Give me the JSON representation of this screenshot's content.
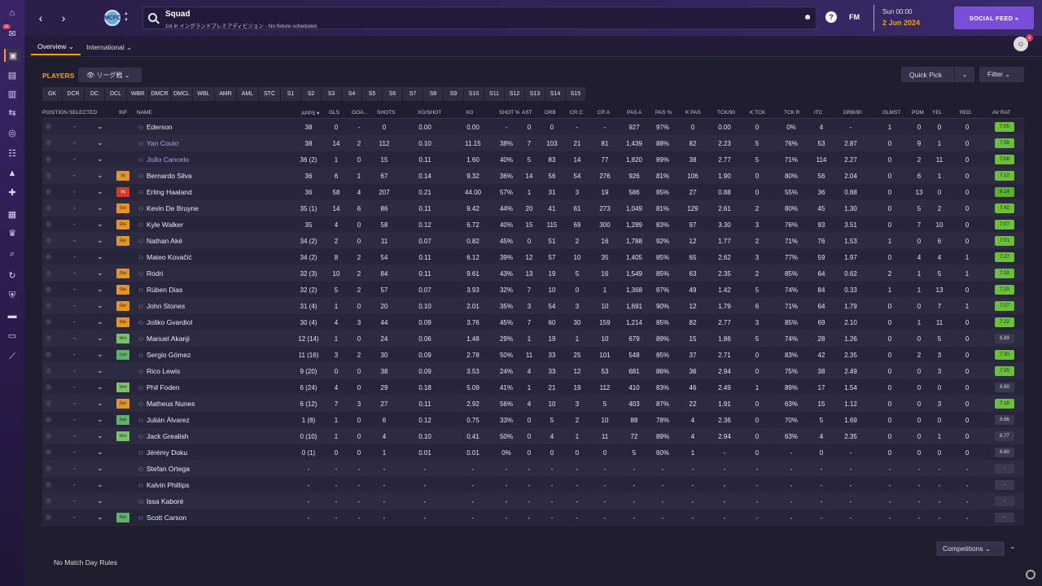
{
  "header": {
    "title": "Squad",
    "subtitle": "1st in イングランドプレミアディビジョン - No fixture scheduled.",
    "fm_label": "FM",
    "date_day": "Sun 00:00",
    "date_date": "2 Jun 2024",
    "social_feed": "SOCIAL FEED  »",
    "club_badge": "MCFC",
    "rail_badge": "16"
  },
  "tabs": [
    {
      "label": "Overview ⌄"
    },
    {
      "label": "International ⌄"
    }
  ],
  "people_badge": "3",
  "players_label": "PLAYERS",
  "view_select": "👁 リーグ戦  ⌄",
  "quick_pick": "Quick Pick",
  "filter": "Filter  ⌄",
  "positions": [
    "GK",
    "DCR",
    "DC",
    "DCL",
    "WBR",
    "DMCR",
    "DMCL",
    "WBL",
    "AMR",
    "AML",
    "STC",
    "S1",
    "S2",
    "S3",
    "S4",
    "S5",
    "S6",
    "S7",
    "S8",
    "S9",
    "S10",
    "S11",
    "S12",
    "S13",
    "S14",
    "S15"
  ],
  "columns": {
    "position_selected": "POSITION SELECTED",
    "inf": "INF",
    "name": "NAME",
    "apps": "APPS ▾",
    "gls": "GLS",
    "goa": "GOA...",
    "shots": "SHOTS",
    "xg_shot": "XG/SHOT",
    "xg": "XG",
    "shot_pct": "SHOT %",
    "ast": "AST",
    "drb": "DRB",
    "cr_c": "CR C",
    "cr_a": "CR A",
    "pas_a": "PAS A",
    "pas_pct": "PAS %",
    "k_pas": "K PAS",
    "tck90": "TCK/90",
    "k_tck": "K TCK",
    "tck_r": "TCK R",
    "itc": "ITC",
    "drb90": "DRB/90",
    "glmst": "GLMST",
    "pom": "POM",
    "yel": "YEL",
    "red": "RED",
    "av_rat": "AV RAT"
  },
  "players": [
    {
      "inf": "",
      "name": "Ederson",
      "loan": false,
      "apps": "38",
      "gls": "0",
      "goa": "-",
      "shots": "0",
      "xgs": "0.00",
      "xg": "0.00",
      "shotp": "-",
      "ast": "0",
      "drb": "0",
      "crc": "-",
      "cra": "-",
      "pasa": "927",
      "pasp": "97%",
      "kpas": "0",
      "tck90": "0.00",
      "ktck": "0",
      "tckr": "0%",
      "itc": "4",
      "drb90": "-",
      "glmst": "1",
      "pom": "0",
      "yel": "0",
      "red": "0",
      "avrat": "7.05",
      "rc": "g"
    },
    {
      "inf": "",
      "name": "Yan Couto",
      "loan": true,
      "apps": "38",
      "gls": "14",
      "goa": "2",
      "shots": "112",
      "xgs": "0.10",
      "xg": "11.15",
      "shotp": "38%",
      "ast": "7",
      "drb": "103",
      "crc": "21",
      "cra": "81",
      "pasa": "1,439",
      "pasp": "88%",
      "kpas": "82",
      "tck90": "2.23",
      "ktck": "5",
      "tckr": "76%",
      "itc": "53",
      "drb90": "2.87",
      "glmst": "0",
      "pom": "9",
      "yel": "1",
      "red": "0",
      "avrat": "7.58",
      "rc": "g"
    },
    {
      "inf": "",
      "name": "João Cancelo",
      "loan": true,
      "apps": "36 (2)",
      "gls": "1",
      "goa": "0",
      "shots": "15",
      "xgs": "0.11",
      "xg": "1.60",
      "shotp": "40%",
      "ast": "5",
      "drb": "83",
      "crc": "14",
      "cra": "77",
      "pasa": "1,820",
      "pasp": "89%",
      "kpas": "38",
      "tck90": "2.77",
      "ktck": "5",
      "tckr": "71%",
      "itc": "114",
      "drb90": "2.27",
      "glmst": "0",
      "pom": "2",
      "yel": "11",
      "red": "0",
      "avrat": "7.08",
      "rc": "g"
    },
    {
      "inf": "Inj",
      "name": "Bernardo Silva",
      "loan": false,
      "apps": "36",
      "gls": "6",
      "goa": "1",
      "shots": "67",
      "xgs": "0.14",
      "xg": "9.32",
      "shotp": "36%",
      "ast": "14",
      "drb": "56",
      "crc": "54",
      "cra": "276",
      "pasa": "926",
      "pasp": "81%",
      "kpas": "106",
      "tck90": "1.90",
      "ktck": "0",
      "tckr": "80%",
      "itc": "56",
      "drb90": "2.04",
      "glmst": "0",
      "pom": "6",
      "yel": "1",
      "red": "0",
      "avrat": "7.12",
      "rc": "g",
      "infc": "rst"
    },
    {
      "inf": "Inj",
      "name": "Erling Haaland",
      "loan": false,
      "apps": "36",
      "gls": "58",
      "goa": "4",
      "shots": "207",
      "xgs": "0.21",
      "xg": "44.00",
      "shotp": "57%",
      "ast": "1",
      "drb": "31",
      "crc": "3",
      "cra": "19",
      "pasa": "586",
      "pasp": "85%",
      "kpas": "27",
      "tck90": "0.88",
      "ktck": "0",
      "tckr": "55%",
      "itc": "36",
      "drb90": "0.88",
      "glmst": "0",
      "pom": "13",
      "yel": "0",
      "red": "0",
      "avrat": "8.14",
      "rc": "dg",
      "infc": "inj"
    },
    {
      "inf": "Rst",
      "name": "Kevin De Bruyne",
      "loan": false,
      "apps": "35 (1)",
      "gls": "14",
      "goa": "6",
      "shots": "86",
      "xgs": "0.11",
      "xg": "9.42",
      "shotp": "44%",
      "ast": "20",
      "drb": "41",
      "crc": "61",
      "cra": "273",
      "pasa": "1,049",
      "pasp": "81%",
      "kpas": "129",
      "tck90": "2.61",
      "ktck": "2",
      "tckr": "80%",
      "itc": "45",
      "drb90": "1.30",
      "glmst": "0",
      "pom": "5",
      "yel": "2",
      "red": "0",
      "avrat": "7.42",
      "rc": "g",
      "infc": "rst"
    },
    {
      "inf": "Rst",
      "name": "Kyle Walker",
      "loan": false,
      "apps": "35",
      "gls": "4",
      "goa": "0",
      "shots": "58",
      "xgs": "0.12",
      "xg": "6.72",
      "shotp": "40%",
      "ast": "15",
      "drb": "115",
      "crc": "69",
      "cra": "300",
      "pasa": "1,289",
      "pasp": "83%",
      "kpas": "97",
      "tck90": "3.30",
      "ktck": "3",
      "tckr": "76%",
      "itc": "93",
      "drb90": "3.51",
      "glmst": "0",
      "pom": "7",
      "yel": "10",
      "red": "0",
      "avrat": "7.07",
      "rc": "g",
      "infc": "rst"
    },
    {
      "inf": "Rst",
      "name": "Nathan Aké",
      "loan": false,
      "apps": "34 (2)",
      "gls": "2",
      "goa": "0",
      "shots": "11",
      "xgs": "0.07",
      "xg": "0.82",
      "shotp": "45%",
      "ast": "0",
      "drb": "51",
      "crc": "2",
      "cra": "16",
      "pasa": "1,788",
      "pasp": "92%",
      "kpas": "12",
      "tck90": "1.77",
      "ktck": "2",
      "tckr": "71%",
      "itc": "76",
      "drb90": "1.53",
      "glmst": "1",
      "pom": "0",
      "yel": "6",
      "red": "0",
      "avrat": "7.01",
      "rc": "g",
      "infc": "rst"
    },
    {
      "inf": "",
      "name": "Mateo Kovačić",
      "loan": false,
      "apps": "34 (2)",
      "gls": "8",
      "goa": "2",
      "shots": "54",
      "xgs": "0.11",
      "xg": "6.12",
      "shotp": "39%",
      "ast": "12",
      "drb": "57",
      "crc": "10",
      "cra": "35",
      "pasa": "1,405",
      "pasp": "85%",
      "kpas": "65",
      "tck90": "2.62",
      "ktck": "3",
      "tckr": "77%",
      "itc": "59",
      "drb90": "1.97",
      "glmst": "0",
      "pom": "4",
      "yel": "4",
      "red": "1",
      "avrat": "7.27",
      "rc": "g"
    },
    {
      "inf": "Rst",
      "name": "Rodri",
      "loan": false,
      "apps": "32 (3)",
      "gls": "10",
      "goa": "2",
      "shots": "84",
      "xgs": "0.11",
      "xg": "9.61",
      "shotp": "43%",
      "ast": "13",
      "drb": "19",
      "crc": "5",
      "cra": "16",
      "pasa": "1,549",
      "pasp": "85%",
      "kpas": "63",
      "tck90": "2.35",
      "ktck": "2",
      "tckr": "85%",
      "itc": "64",
      "drb90": "0.62",
      "glmst": "2",
      "pom": "1",
      "yel": "5",
      "red": "1",
      "avrat": "7.32",
      "rc": "g",
      "infc": "rst"
    },
    {
      "inf": "Rst",
      "name": "Rúben Dias",
      "loan": false,
      "apps": "32 (2)",
      "gls": "5",
      "goa": "2",
      "shots": "57",
      "xgs": "0.07",
      "xg": "3.93",
      "shotp": "32%",
      "ast": "7",
      "drb": "10",
      "crc": "0",
      "cra": "1",
      "pasa": "1,368",
      "pasp": "87%",
      "kpas": "49",
      "tck90": "1.42",
      "ktck": "5",
      "tckr": "74%",
      "itc": "84",
      "drb90": "0.33",
      "glmst": "1",
      "pom": "1",
      "yel": "13",
      "red": "0",
      "avrat": "7.20",
      "rc": "g",
      "infc": "rst"
    },
    {
      "inf": "Rst",
      "name": "John Stones",
      "loan": false,
      "apps": "31 (4)",
      "gls": "1",
      "goa": "0",
      "shots": "20",
      "xgs": "0.10",
      "xg": "2.01",
      "shotp": "35%",
      "ast": "3",
      "drb": "54",
      "crc": "3",
      "cra": "10",
      "pasa": "1,691",
      "pasp": "90%",
      "kpas": "12",
      "tck90": "1.79",
      "ktck": "6",
      "tckr": "71%",
      "itc": "64",
      "drb90": "1.79",
      "glmst": "0",
      "pom": "0",
      "yel": "7",
      "red": "1",
      "avrat": "7.07",
      "rc": "g",
      "infc": "rst"
    },
    {
      "inf": "Rst",
      "name": "Joško Gvardiol",
      "loan": false,
      "apps": "30 (4)",
      "gls": "4",
      "goa": "3",
      "shots": "44",
      "xgs": "0.09",
      "xg": "3.76",
      "shotp": "45%",
      "ast": "7",
      "drb": "60",
      "crc": "30",
      "cra": "159",
      "pasa": "1,214",
      "pasp": "85%",
      "kpas": "82",
      "tck90": "2.77",
      "ktck": "3",
      "tckr": "85%",
      "itc": "69",
      "drb90": "2.10",
      "glmst": "0",
      "pom": "1",
      "yel": "11",
      "red": "0",
      "avrat": "7.22",
      "rc": "g",
      "infc": "rst"
    },
    {
      "inf": "Wnt",
      "name": "Manuel Akanji",
      "loan": false,
      "apps": "12 (14)",
      "gls": "1",
      "goa": "0",
      "shots": "24",
      "xgs": "0.06",
      "xg": "1.48",
      "shotp": "29%",
      "ast": "1",
      "drb": "19",
      "crc": "1",
      "cra": "10",
      "pasa": "679",
      "pasp": "89%",
      "kpas": "15",
      "tck90": "1.86",
      "ktck": "5",
      "tckr": "74%",
      "itc": "28",
      "drb90": "1.26",
      "glmst": "0",
      "pom": "0",
      "yel": "5",
      "red": "0",
      "avrat": "6.89",
      "rc": "n",
      "infc": "wnt"
    },
    {
      "inf": "Loa",
      "name": "Sergio Gómez",
      "loan": false,
      "apps": "11 (16)",
      "gls": "3",
      "goa": "2",
      "shots": "30",
      "xgs": "0.09",
      "xg": "2.78",
      "shotp": "50%",
      "ast": "11",
      "drb": "33",
      "crc": "25",
      "cra": "101",
      "pasa": "548",
      "pasp": "85%",
      "kpas": "37",
      "tck90": "2.71",
      "ktck": "0",
      "tckr": "83%",
      "itc": "42",
      "drb90": "2.35",
      "glmst": "0",
      "pom": "2",
      "yel": "3",
      "red": "0",
      "avrat": "7.30",
      "rc": "g",
      "infc": "loa"
    },
    {
      "inf": "",
      "name": "Rico Lewis",
      "loan": false,
      "apps": "9 (20)",
      "gls": "0",
      "goa": "0",
      "shots": "38",
      "xgs": "0.09",
      "xg": "3.53",
      "shotp": "24%",
      "ast": "4",
      "drb": "33",
      "crc": "12",
      "cra": "53",
      "pasa": "681",
      "pasp": "86%",
      "kpas": "36",
      "tck90": "2.94",
      "ktck": "0",
      "tckr": "75%",
      "itc": "38",
      "drb90": "2.49",
      "glmst": "0",
      "pom": "0",
      "yel": "3",
      "red": "0",
      "avrat": "7.05",
      "rc": "g"
    },
    {
      "inf": "Wnt",
      "name": "Phil Foden",
      "loan": false,
      "apps": "6 (24)",
      "gls": "4",
      "goa": "0",
      "shots": "29",
      "xgs": "0.18",
      "xg": "5.09",
      "shotp": "41%",
      "ast": "1",
      "drb": "21",
      "crc": "19",
      "cra": "112",
      "pasa": "410",
      "pasp": "83%",
      "kpas": "46",
      "tck90": "2.49",
      "ktck": "1",
      "tckr": "89%",
      "itc": "17",
      "drb90": "1.54",
      "glmst": "0",
      "pom": "0",
      "yel": "0",
      "red": "0",
      "avrat": "6.90",
      "rc": "n",
      "infc": "wnt"
    },
    {
      "inf": "Rst",
      "name": "Matheus Nunes",
      "loan": false,
      "apps": "6 (12)",
      "gls": "7",
      "goa": "3",
      "shots": "27",
      "xgs": "0.11",
      "xg": "2.92",
      "shotp": "56%",
      "ast": "4",
      "drb": "10",
      "crc": "3",
      "cra": "5",
      "pasa": "403",
      "pasp": "87%",
      "kpas": "22",
      "tck90": "1.91",
      "ktck": "0",
      "tckr": "63%",
      "itc": "15",
      "drb90": "1.12",
      "glmst": "0",
      "pom": "0",
      "yel": "3",
      "red": "0",
      "avrat": "7.18",
      "rc": "g",
      "infc": "rst"
    },
    {
      "inf": "Ask",
      "name": "Julián Álvarez",
      "loan": false,
      "apps": "1 (8)",
      "gls": "1",
      "goa": "0",
      "shots": "6",
      "xgs": "0.12",
      "xg": "0.75",
      "shotp": "33%",
      "ast": "0",
      "drb": "5",
      "crc": "2",
      "cra": "10",
      "pasa": "88",
      "pasp": "78%",
      "kpas": "4",
      "tck90": "2.36",
      "ktck": "0",
      "tckr": "70%",
      "itc": "5",
      "drb90": "1.69",
      "glmst": "0",
      "pom": "0",
      "yel": "0",
      "red": "0",
      "avrat": "6.66",
      "rc": "n",
      "infc": "ret"
    },
    {
      "inf": "Wnt",
      "name": "Jack Grealish",
      "loan": false,
      "apps": "0 (10)",
      "gls": "1",
      "goa": "0",
      "shots": "4",
      "xgs": "0.10",
      "xg": "0.41",
      "shotp": "50%",
      "ast": "0",
      "drb": "4",
      "crc": "1",
      "cra": "11",
      "pasa": "72",
      "pasp": "89%",
      "kpas": "4",
      "tck90": "2.94",
      "ktck": "0",
      "tckr": "63%",
      "itc": "4",
      "drb90": "2.35",
      "glmst": "0",
      "pom": "0",
      "yel": "1",
      "red": "0",
      "avrat": "6.77",
      "rc": "n",
      "infc": "wnt"
    },
    {
      "inf": "",
      "name": "Jérémy Doku",
      "loan": false,
      "apps": "0 (1)",
      "gls": "0",
      "goa": "0",
      "shots": "1",
      "xgs": "0.01",
      "xg": "0.01",
      "shotp": "0%",
      "ast": "0",
      "drb": "0",
      "crc": "0",
      "cra": "0",
      "pasa": "5",
      "pasp": "60%",
      "kpas": "1",
      "tck90": "-",
      "ktck": "0",
      "tckr": "-",
      "itc": "0",
      "drb90": "-",
      "glmst": "0",
      "pom": "0",
      "yel": "0",
      "red": "0",
      "avrat": "6.80",
      "rc": "n"
    },
    {
      "inf": "",
      "name": "Stefan Ortega",
      "loan": false,
      "apps": "-",
      "gls": "-",
      "goa": "-",
      "shots": "-",
      "xgs": "-",
      "xg": "-",
      "shotp": "-",
      "ast": "-",
      "drb": "-",
      "crc": "-",
      "cra": "-",
      "pasa": "-",
      "pasp": "-",
      "kpas": "-",
      "tck90": "-",
      "ktck": "-",
      "tckr": "-",
      "itc": "-",
      "drb90": "-",
      "glmst": "-",
      "pom": "-",
      "yel": "-",
      "red": "-",
      "avrat": "-",
      "rc": "n"
    },
    {
      "inf": "",
      "name": "Kalvin Phillips",
      "loan": false,
      "apps": "-",
      "gls": "-",
      "goa": "-",
      "shots": "-",
      "xgs": "-",
      "xg": "-",
      "shotp": "-",
      "ast": "-",
      "drb": "-",
      "crc": "-",
      "cra": "-",
      "pasa": "-",
      "pasp": "-",
      "kpas": "-",
      "tck90": "-",
      "ktck": "-",
      "tckr": "-",
      "itc": "-",
      "drb90": "-",
      "glmst": "-",
      "pom": "-",
      "yel": "-",
      "red": "-",
      "avrat": "-",
      "rc": "n"
    },
    {
      "inf": "",
      "name": "Issa Kaboré",
      "loan": false,
      "apps": "-",
      "gls": "-",
      "goa": "-",
      "shots": "-",
      "xgs": "-",
      "xg": "-",
      "shotp": "-",
      "ast": "-",
      "drb": "-",
      "crc": "-",
      "cra": "-",
      "pasa": "-",
      "pasp": "-",
      "kpas": "-",
      "tck90": "-",
      "ktck": "-",
      "tckr": "-",
      "itc": "-",
      "drb90": "-",
      "glmst": "-",
      "pom": "-",
      "yel": "-",
      "red": "-",
      "avrat": "-",
      "rc": "n"
    },
    {
      "inf": "Ret",
      "name": "Scott Carson",
      "loan": false,
      "apps": "-",
      "gls": "-",
      "goa": "-",
      "shots": "-",
      "xgs": "-",
      "xg": "-",
      "shotp": "-",
      "ast": "-",
      "drb": "-",
      "crc": "-",
      "cra": "-",
      "pasa": "-",
      "pasp": "-",
      "kpas": "-",
      "tck90": "-",
      "ktck": "-",
      "tckr": "-",
      "itc": "-",
      "drb90": "-",
      "glmst": "-",
      "pom": "-",
      "yel": "-",
      "red": "-",
      "avrat": "-",
      "rc": "n",
      "infc": "ret"
    }
  ],
  "footer": {
    "rules": "No Match Day Rules",
    "competitions": "Competitions  ⌄"
  }
}
